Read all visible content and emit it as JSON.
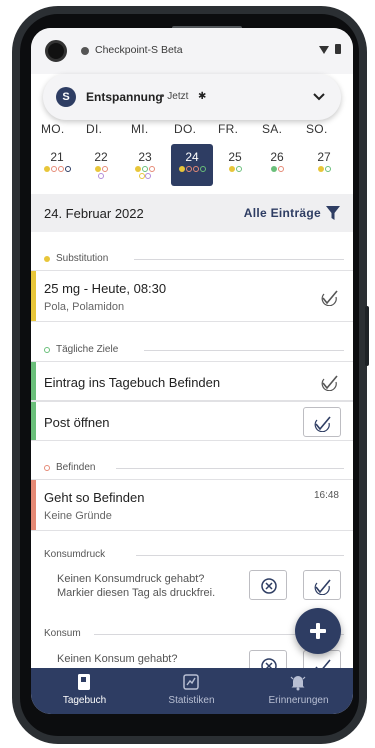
{
  "status_bar": {
    "app_name": "Checkpoint-S Beta"
  },
  "notification": {
    "icon_letter": "S",
    "title": "Entspannung",
    "meta": "• Jetzt",
    "bug_glyph": "✱"
  },
  "calendar": {
    "weekdays": [
      "MO.",
      "DI.",
      "MI.",
      "DO.",
      "FR.",
      "SA.",
      "SO."
    ],
    "days": [
      {
        "num": "21",
        "selected": false,
        "dots": [
          "#e8c63a",
          "#e58a76",
          "#e58a76",
          "#2e3d63"
        ],
        "fill": [
          true,
          false,
          false,
          false
        ]
      },
      {
        "num": "22",
        "selected": false,
        "dots": [
          "#e8c63a",
          "#e58a76"
        ],
        "dots2": [
          "#b38cd9"
        ]
      },
      {
        "num": "23",
        "selected": false,
        "dots": [
          "#e8c63a",
          "#6abf7a",
          "#e58a76"
        ],
        "dots2": [
          "#e8c63a",
          "#b38cd9"
        ]
      },
      {
        "num": "24",
        "selected": true,
        "dots": [
          "#e8c63a",
          "#e58a76",
          "#e58a76",
          "#6abf7a"
        ]
      },
      {
        "num": "25",
        "selected": false,
        "dots": [
          "#e8c63a",
          "#6abf7a"
        ]
      },
      {
        "num": "26",
        "selected": false,
        "dots": [
          "#6abf7a",
          "#e58a76"
        ]
      },
      {
        "num": "27",
        "selected": false,
        "dots": [
          "#e8c63a",
          "#6abf7a"
        ]
      }
    ]
  },
  "date_bar": {
    "date": "24. Februar 2022",
    "filter_label": "Alle Einträge"
  },
  "sections": {
    "substitution": {
      "label": "Substitution",
      "color": "#e8c63a"
    },
    "goals": {
      "label": "Tägliche Ziele",
      "color": "#6abf7a"
    },
    "befinden": {
      "label": "Befinden",
      "color": "#e58a76"
    },
    "konsumdruck": {
      "label": "Konsumdruck"
    },
    "konsum": {
      "label": "Konsum"
    }
  },
  "entries": {
    "substitution": {
      "title": "25 mg - Heute, 08:30",
      "sub": "Pola, Polamidon"
    },
    "goal1": {
      "title": "Eintrag ins Tagebuch Befinden"
    },
    "goal2": {
      "title": "Post öffnen"
    },
    "befinden": {
      "title": "Geht so Befinden",
      "sub": "Keine Gründe",
      "time": "16:48"
    },
    "konsumdruck": {
      "line1": "Keinen Konsumdruck gehabt?",
      "line2": "Markier diesen Tag als druckfrei."
    },
    "konsum": {
      "line1": "Keinen Konsum gehabt?"
    }
  },
  "bottom_nav": [
    {
      "label": "Tagebuch",
      "icon": "diary-icon",
      "active": true
    },
    {
      "label": "Statistiken",
      "icon": "statistics-icon",
      "active": false
    },
    {
      "label": "Erinnerungen",
      "icon": "bell-icon",
      "active": false
    }
  ],
  "colors": {
    "primary": "#2e3d63",
    "yellow": "#e8c63a",
    "green": "#6abf7a",
    "red": "#e58a76",
    "purple": "#b38cd9"
  }
}
